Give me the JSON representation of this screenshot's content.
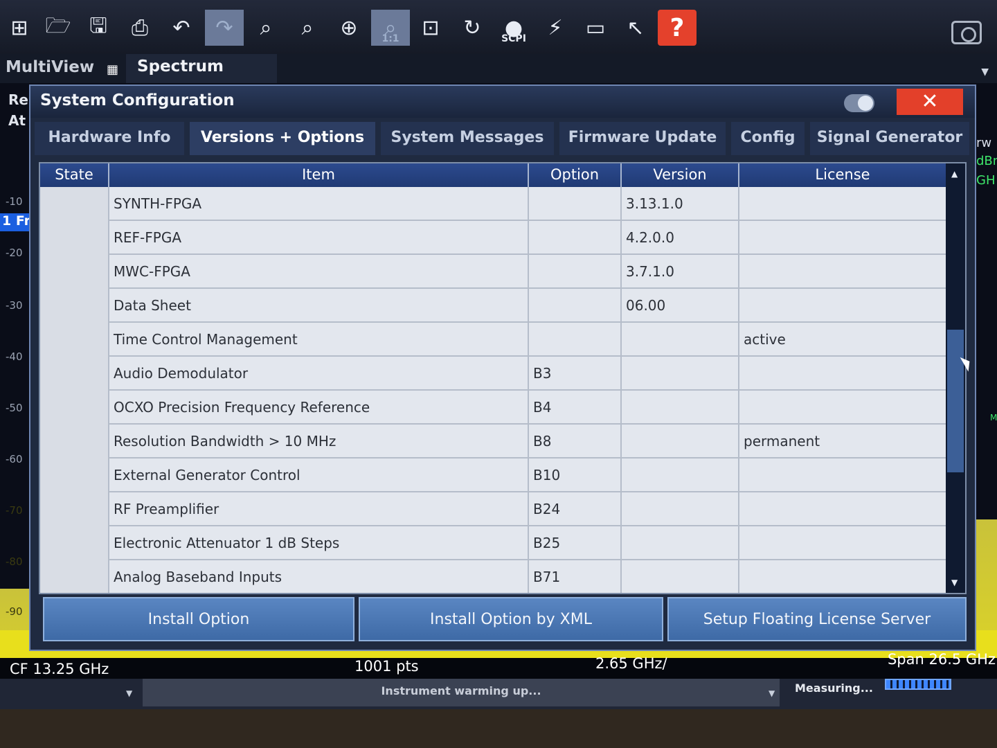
{
  "toolbar": {
    "buttons": [
      {
        "icon": "windows-icon"
      },
      {
        "icon": "open-folder-icon"
      },
      {
        "icon": "save-icon"
      },
      {
        "icon": "print-icon"
      },
      {
        "icon": "undo-icon"
      },
      {
        "icon": "redo-icon"
      },
      {
        "icon": "zoom-icon"
      },
      {
        "icon": "multi-zoom-icon"
      },
      {
        "icon": "zoom-in-icon"
      },
      {
        "icon": "zoom-off-icon",
        "label": "1:1"
      },
      {
        "icon": "full-screen-icon"
      },
      {
        "icon": "refresh-icon"
      },
      {
        "icon": "scpi-icon",
        "label": "SCPI"
      },
      {
        "icon": "sequencer-icon"
      },
      {
        "icon": "display-icon"
      },
      {
        "icon": "help-pointer-icon"
      },
      {
        "icon": "help-icon",
        "label": "?"
      }
    ]
  },
  "multiview": {
    "label": "MultiView",
    "tab": "Spectrum"
  },
  "background": {
    "left_stubs": [
      "Re",
      "At"
    ],
    "trace_label": "1 Fr",
    "y_ticks": [
      "-10",
      "-20",
      "-30",
      "-40",
      "-50",
      "-60",
      "-70",
      "-80",
      "-90"
    ],
    "right_stubs": [
      "rw",
      "dBn",
      "GH",
      "M"
    ]
  },
  "freq": {
    "cf": "CF 13.25 GHz",
    "pts": "1001 pts",
    "div": "2.65 GHz/",
    "span": "Span 26.5 GHz"
  },
  "status": {
    "message": "Instrument warming up...",
    "measuring": "Measuring..."
  },
  "dialog": {
    "title": "System Configuration",
    "close": "✕",
    "tabs": [
      {
        "label": "Hardware Info",
        "active": false
      },
      {
        "label": "Versions + Options",
        "active": true
      },
      {
        "label": "System Messages",
        "active": false
      },
      {
        "label": "Firmware Update",
        "active": false
      },
      {
        "label": "Config",
        "active": false
      },
      {
        "label": "Signal Generator",
        "active": false
      }
    ],
    "table": {
      "headers": [
        "State",
        "Item",
        "Option",
        "Version",
        "License"
      ],
      "rows": [
        {
          "state": "",
          "item": "SYNTH-FPGA",
          "option": "",
          "version": "3.13.1.0",
          "license": ""
        },
        {
          "state": "",
          "item": "REF-FPGA",
          "option": "",
          "version": "4.2.0.0",
          "license": ""
        },
        {
          "state": "",
          "item": "MWC-FPGA",
          "option": "",
          "version": "3.7.1.0",
          "license": ""
        },
        {
          "state": "",
          "item": "Data Sheet",
          "option": "",
          "version": "06.00",
          "license": ""
        },
        {
          "state": "",
          "item": "Time Control Management",
          "option": "",
          "version": "",
          "license": "active"
        },
        {
          "state": "",
          "item": "Audio Demodulator",
          "option": "B3",
          "version": "",
          "license": ""
        },
        {
          "state": "",
          "item": "OCXO Precision Frequency Reference",
          "option": "B4",
          "version": "",
          "license": ""
        },
        {
          "state": "",
          "item": "Resolution Bandwidth > 10 MHz",
          "option": "B8",
          "version": "",
          "license": "permanent"
        },
        {
          "state": "",
          "item": "External Generator Control",
          "option": "B10",
          "version": "",
          "license": ""
        },
        {
          "state": "",
          "item": "RF Preamplifier",
          "option": "B24",
          "version": "",
          "license": ""
        },
        {
          "state": "",
          "item": "Electronic Attenuator 1 dB Steps",
          "option": "B25",
          "version": "",
          "license": ""
        },
        {
          "state": "",
          "item": "Analog Baseband Inputs",
          "option": "B71",
          "version": "",
          "license": ""
        }
      ]
    },
    "buttons": [
      "Install Option",
      "Install Option by XML",
      "Setup Floating License Server"
    ]
  }
}
